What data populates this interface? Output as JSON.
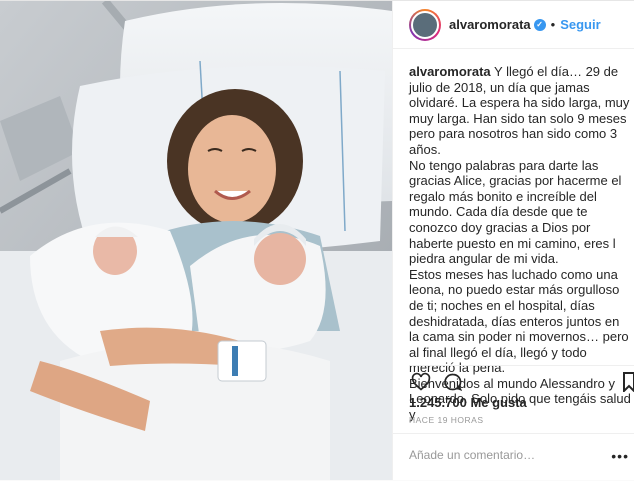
{
  "post": {
    "username": "alvaromorata",
    "follow_label": "Seguir",
    "separator": "•",
    "verified_glyph": "✓",
    "caption_user": "alvaromorata",
    "caption_lines": [
      " Y llegó el día… 29 de julio de 2018, un día que jamas olvidaré. La espera ha sido larga, muy muy larga. Han sido tan solo 9 meses pero para nosotros han sido como 3 años.",
      "No tengo palabras para darte las gracias Alice, gracias por hacerme el regalo más bonito e increíble del mundo. Cada día desde que te conozco doy gracias a Dios por haberte puesto en mi camino, eres l piedra angular de mi vida.",
      "Estos meses has luchado como una leona, no puedo estar más orgulloso de ti; noches en el hospital, días deshidratada, días enteros juntos en la cama sin poder ni movernos… pero al final llegó el día, llegó y todo mereció la pena.",
      "Bienvenidos al mundo Alessandro y Leonardo. Solo pido que tengáis salud y"
    ],
    "likes": "1.245.700 Me gusta",
    "time": "HACE 19 HORAS",
    "comment_placeholder": "Añade un comentario…",
    "more": "•••"
  },
  "icons": [
    "heart-icon",
    "comment-icon",
    "bookmark-icon",
    "verified-badge-icon"
  ],
  "colors": {
    "link": "#3897f0",
    "text": "#262626",
    "muted": "#999999",
    "border": "#efefef"
  }
}
